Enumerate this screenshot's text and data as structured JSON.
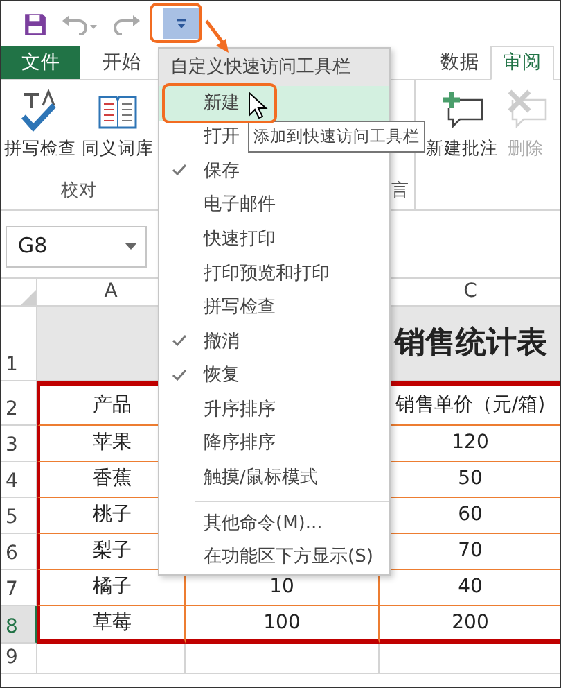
{
  "quick_access_toolbar": {
    "customize_pressed": true
  },
  "tabs": [
    {
      "kind": "file",
      "label": "文件",
      "selected": false
    },
    {
      "kind": "tab",
      "label": "开始",
      "selected": false
    },
    {
      "kind": "tab",
      "label": "数据",
      "selected": false
    },
    {
      "kind": "tab",
      "label": "审阅",
      "selected": true
    }
  ],
  "ribbon_groups": [
    {
      "label": "校对",
      "buttons": [
        {
          "kind": "spell-check",
          "label": "拼写检查",
          "disabled": false
        },
        {
          "kind": "thesaurus",
          "label": "同义词库",
          "disabled": false
        }
      ]
    },
    {
      "label": "言"
    },
    {
      "buttons": [
        {
          "kind": "new-comment",
          "label": "新建批注",
          "disabled": false
        },
        {
          "kind": "delete-comment",
          "label": "删除",
          "disabled": true
        }
      ]
    }
  ],
  "name_box": "G8",
  "sheet": {
    "column_headers": [
      "A",
      "C"
    ],
    "rows": [
      {
        "kind": "title",
        "number": "1",
        "title": "销售统计表",
        "selected": false
      },
      {
        "kind": "header",
        "number": "2",
        "column_1": "产品",
        "column_3": "销售单价（元/箱)",
        "selected": false
      },
      {
        "kind": "data",
        "number": "3",
        "column_1": "苹果",
        "column_3": "120",
        "selected": false
      },
      {
        "kind": "data",
        "number": "4",
        "column_1": "香蕉",
        "column_3": "50",
        "selected": false
      },
      {
        "kind": "data",
        "number": "5",
        "column_1": "桃子",
        "column_3": "60",
        "selected": false
      },
      {
        "kind": "data",
        "number": "6",
        "column_1": "梨子",
        "column_3": "70",
        "selected": false
      },
      {
        "kind": "data",
        "number": "7",
        "column_1": "橘子",
        "column_2": "10",
        "column_3": "40",
        "selected": false
      },
      {
        "kind": "data",
        "number": "8",
        "column_1": "草莓",
        "column_2": "100",
        "column_3": "200",
        "selected": true
      },
      {
        "kind": "empty",
        "number": "9",
        "selected": false
      }
    ]
  },
  "menu": {
    "title": "自定义快速访问工具栏",
    "items": [
      {
        "kind": "option",
        "label": "新建",
        "checked": false,
        "hovered": true
      },
      {
        "kind": "option",
        "label": "打开",
        "checked": false,
        "hovered": false
      },
      {
        "kind": "option",
        "label": "保存",
        "checked": true,
        "hovered": false
      },
      {
        "kind": "option",
        "label": "电子邮件",
        "checked": false,
        "hovered": false
      },
      {
        "kind": "option",
        "label": "快速打印",
        "checked": false,
        "hovered": false
      },
      {
        "kind": "option",
        "label": "打印预览和打印",
        "checked": false,
        "hovered": false
      },
      {
        "kind": "option",
        "label": "拼写检查",
        "checked": false,
        "hovered": false
      },
      {
        "kind": "option",
        "label": "撤消",
        "checked": true,
        "hovered": false
      },
      {
        "kind": "option",
        "label": "恢复",
        "checked": true,
        "hovered": false
      },
      {
        "kind": "option",
        "label": "升序排序",
        "checked": false,
        "hovered": false
      },
      {
        "kind": "option",
        "label": "降序排序",
        "checked": false,
        "hovered": false
      },
      {
        "kind": "option",
        "label": "触摸/鼠标模式",
        "checked": false,
        "hovered": false
      },
      {
        "kind": "separator"
      },
      {
        "kind": "command",
        "label": "其他命令(M)..."
      },
      {
        "kind": "command",
        "label": "在功能区下方显示(S)"
      }
    ]
  },
  "tooltip": "添加到快速访问工具栏"
}
